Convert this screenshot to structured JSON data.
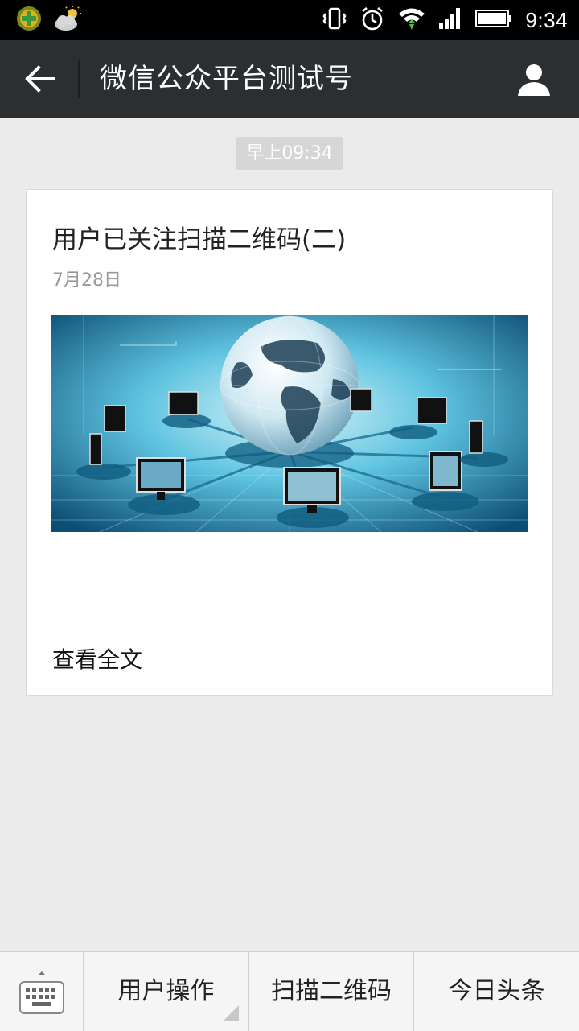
{
  "status_bar": {
    "time": "9:34",
    "left_icons": [
      "app-notification-icon",
      "weather-icon"
    ],
    "right_icons": [
      "vibrate-icon",
      "alarm-icon",
      "wifi-icon",
      "signal-icon",
      "battery-icon"
    ]
  },
  "header": {
    "title": "微信公众平台测试号",
    "back_icon": "arrow-left-icon",
    "profile_icon": "person-icon"
  },
  "chat": {
    "timestamp": "早上09:34",
    "article": {
      "title": "用户已关注扫描二维码(二)",
      "date": "7月28日",
      "cover_image": "globe-network-illustration",
      "read_more": "查看全文"
    }
  },
  "bottom_menu": {
    "keyboard_icon": "keyboard-icon",
    "items": [
      {
        "label": "用户操作",
        "has_submenu": true
      },
      {
        "label": "扫描二维码",
        "has_submenu": false
      },
      {
        "label": "今日头条",
        "has_submenu": false
      }
    ]
  },
  "colors": {
    "header_bg": "#2b2f31",
    "page_bg": "#ebebeb",
    "timestamp_bg": "#d6d6d6"
  }
}
